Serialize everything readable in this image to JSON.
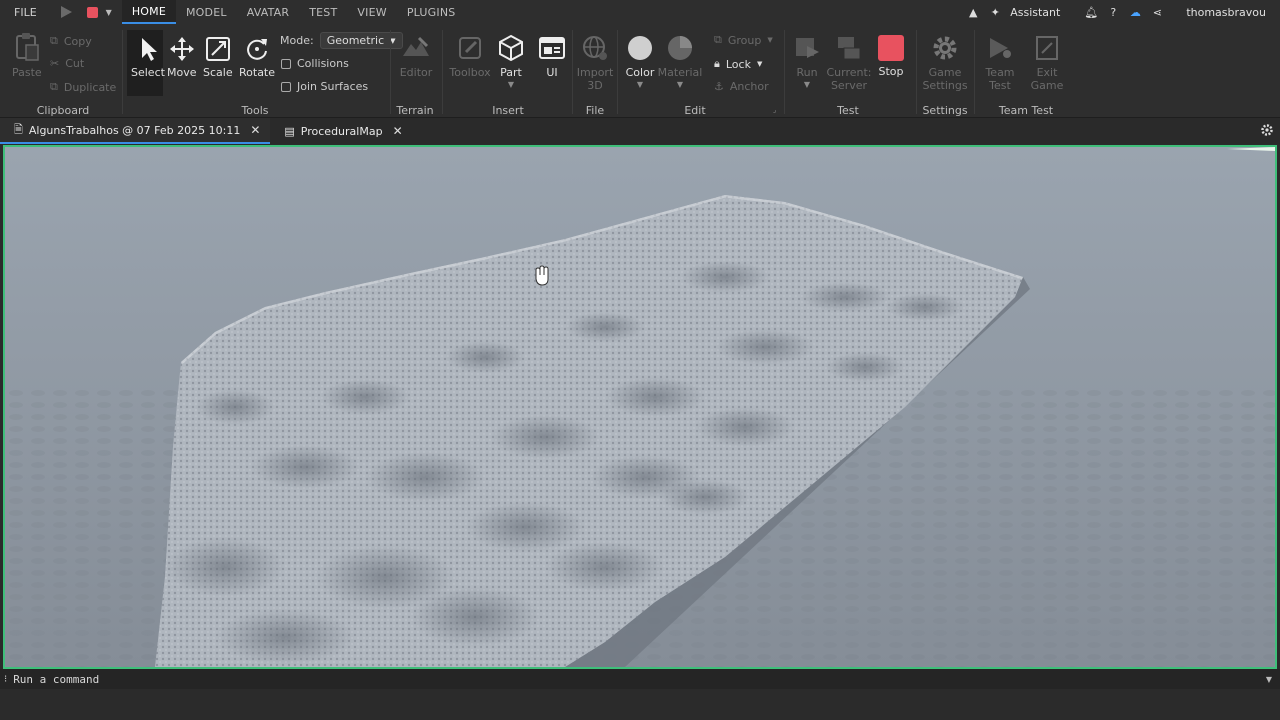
{
  "menubar": {
    "file": "FILE",
    "tabs": [
      "HOME",
      "MODEL",
      "AVATAR",
      "TEST",
      "VIEW",
      "PLUGINS"
    ],
    "assistant": "Assistant",
    "user": "thomasbravou"
  },
  "ribbon": {
    "clipboard": {
      "paste": "Paste",
      "copy": "Copy",
      "cut": "Cut",
      "duplicate": "Duplicate",
      "label": "Clipboard"
    },
    "tools": {
      "select": "Select",
      "move": "Move",
      "scale": "Scale",
      "rotate": "Rotate",
      "mode_label": "Mode:",
      "mode_value": "Geometric",
      "collisions": "Collisions",
      "join_surfaces": "Join Surfaces",
      "label": "Tools"
    },
    "terrain": {
      "editor": "Editor",
      "label": "Terrain"
    },
    "insert": {
      "toolbox": "Toolbox",
      "part": "Part",
      "ui": "UI",
      "label": "Insert"
    },
    "file": {
      "import3d_1": "Import",
      "import3d_2": "3D",
      "label": "File"
    },
    "edit": {
      "color": "Color",
      "material": "Material",
      "group": "Group",
      "lock": "Lock",
      "anchor": "Anchor",
      "label": "Edit"
    },
    "test": {
      "run": "Run",
      "current_1": "Current:",
      "current_2": "Server",
      "stop": "Stop",
      "label": "Test"
    },
    "settings": {
      "game_1": "Game",
      "game_2": "Settings",
      "label": "Settings"
    },
    "team_test": {
      "team_1": "Team",
      "team_2": "Test",
      "exit_1": "Exit",
      "exit_2": "Game",
      "label": "Team Test"
    }
  },
  "doctabs": [
    {
      "label": "AlgunsTrabalhos @ 07 Feb 2025 10:11"
    },
    {
      "label": "ProceduralMap"
    }
  ],
  "command_bar": {
    "prompt": "⁝",
    "placeholder": "Run a command"
  },
  "colors": {
    "accent": "#3a8ee6",
    "viewport_border": "#3fbf7a",
    "stop": "#e8525f"
  }
}
